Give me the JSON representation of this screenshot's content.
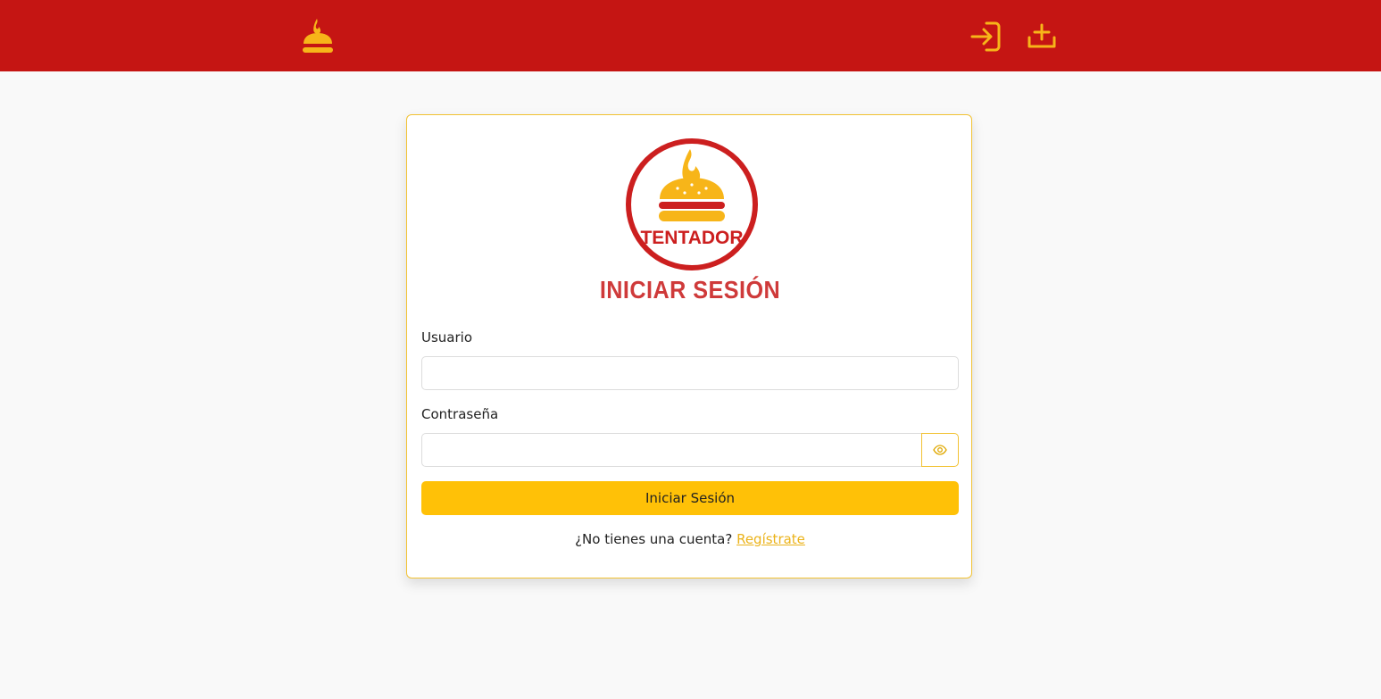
{
  "navbar": {
    "logo_icon": "burger-flame-icon",
    "login_icon": "login-icon",
    "register_icon": "add-upload-icon",
    "background_color": "#c51513",
    "icon_color": "#f7b519"
  },
  "card": {
    "logo_text": "TENTADOR",
    "title": "INICIAR SESIÓN",
    "username_label": "Usuario",
    "username_value": "",
    "password_label": "Contraseña",
    "password_value": "",
    "toggle_icon": "eye-icon",
    "submit_label": "Iniciar Sesión",
    "no_account_text": "¿No tienes una cuenta?",
    "register_link": "Regístrate",
    "accent_color": "#ffc107",
    "title_color": "#cf3a3a"
  }
}
